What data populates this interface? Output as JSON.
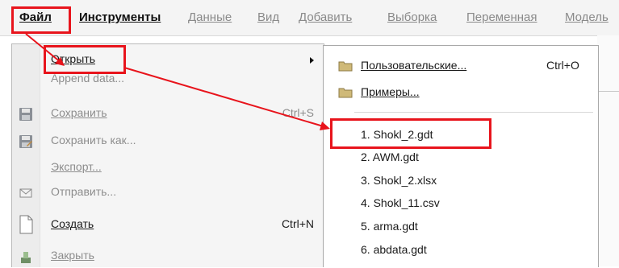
{
  "menubar": {
    "items": [
      "Файл",
      "Инструменты",
      "Данные",
      "Вид",
      "Добавить",
      "Выборка",
      "Переменная",
      "Модель"
    ]
  },
  "file_menu": {
    "items": [
      {
        "label": "Открыть",
        "shortcut": "",
        "icon": "",
        "enabled": true,
        "has_submenu": true
      },
      {
        "label": "Append data...",
        "shortcut": "",
        "icon": "",
        "enabled": false
      },
      {
        "label": "Сохранить",
        "shortcut": "Ctrl+S",
        "icon": "save-icon",
        "enabled": false
      },
      {
        "label": "Сохранить как...",
        "shortcut": "",
        "icon": "save-as-icon",
        "enabled": false
      },
      {
        "label": "Экспорт...",
        "shortcut": "",
        "icon": "",
        "enabled": false
      },
      {
        "label": "Отправить...",
        "shortcut": "",
        "icon": "mail-icon",
        "enabled": false
      },
      {
        "label": "Создать",
        "shortcut": "Ctrl+N",
        "icon": "new-document-icon",
        "enabled": true
      },
      {
        "label": "Закрыть",
        "shortcut": "",
        "icon": "close-dataset-icon",
        "enabled": false
      }
    ]
  },
  "open_submenu": {
    "folders": [
      {
        "label": "Пользовательские...",
        "shortcut": "Ctrl+O"
      },
      {
        "label": "Примеры...",
        "shortcut": ""
      }
    ],
    "recent_files": [
      "1. Shokl_2.gdt",
      "2. AWM.gdt",
      "3. Shokl_2.xlsx",
      "4. Shokl_11.csv",
      "5. arma.gdt",
      "6. abdata.gdt"
    ]
  },
  "colors": {
    "highlight": "#e8141c",
    "menubar": "#f4f4f4",
    "folder": "#cfb978"
  }
}
